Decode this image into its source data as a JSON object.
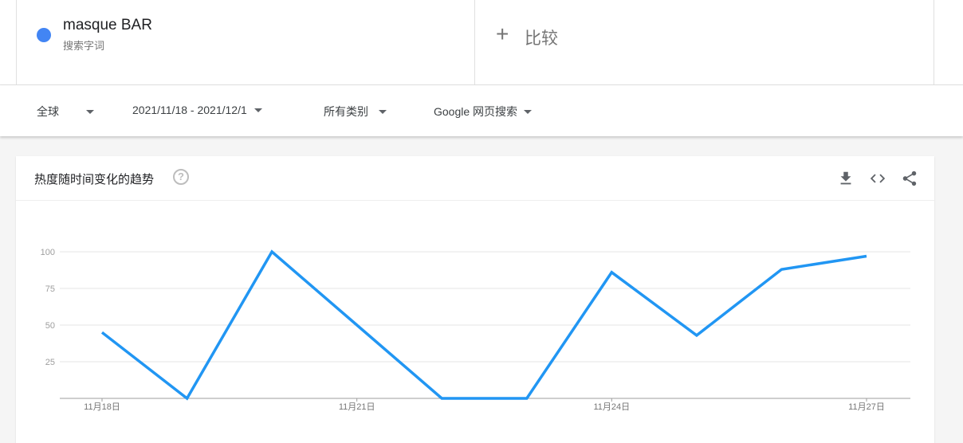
{
  "search_term": {
    "name": "masque BAR",
    "type_label": "搜索字词",
    "color": "#4285f4"
  },
  "compare": {
    "plus": "+",
    "label": "比较"
  },
  "filters": {
    "region": "全球",
    "date_range": "2021/11/18 - 2021/12/1",
    "category": "所有类别",
    "property": "Google 网页搜索"
  },
  "card": {
    "title": "热度随时间变化的趋势",
    "help": "?",
    "icons": [
      "download-icon",
      "embed-icon",
      "share-icon"
    ]
  },
  "chart_data": {
    "type": "line",
    "x": [
      "11月18日",
      "11月19日",
      "11月20日",
      "11月21日",
      "11月22日",
      "11月23日",
      "11月24日",
      "11月25日",
      "11月26日",
      "11月27日"
    ],
    "x_tick_labels": [
      "11月18日",
      "11月21日",
      "11月24日",
      "11月27日"
    ],
    "series": [
      {
        "values": [
          45,
          0,
          100,
          50,
          0,
          0,
          86,
          43,
          88,
          97
        ],
        "color": "#2196f3"
      }
    ],
    "y_ticks": [
      25,
      50,
      75,
      100
    ],
    "ylim": [
      0,
      100
    ],
    "grid": true
  }
}
